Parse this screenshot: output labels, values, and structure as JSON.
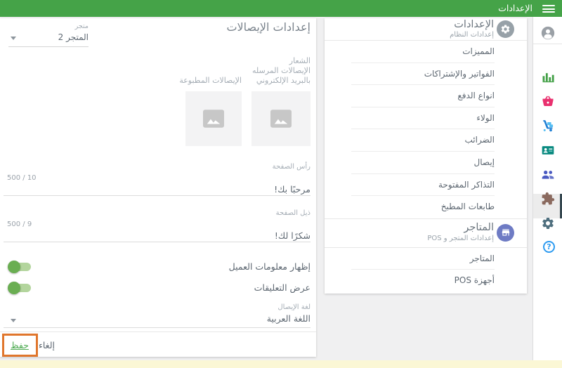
{
  "header": {
    "title": "الإعدادات"
  },
  "main_panel": {
    "title": "إعدادات الإيصالات",
    "store_select": {
      "label": "متجر",
      "value": "المتجر 2"
    },
    "logo_label": "الشعار",
    "email_receipts_label": "الإيصالات المرسله بالبريد الإلكتروني",
    "email_receipts_line1": "الإيصالات المرسله",
    "email_receipts_line2": "بالبريد الإلكتروني",
    "printed_receipts_label": "الإيصالات المطبوعة",
    "header_field": {
      "label": "رأس الصفحة",
      "counter": "500 / 10",
      "value": "مرحبًا بك!"
    },
    "footer_field": {
      "label": "ذيل الصفحة",
      "counter": "500 / 9",
      "value": "شكرًا لك!"
    },
    "toggles": [
      {
        "label": "إظهار معلومات العميل",
        "on": true
      },
      {
        "label": "عرض التعليقات",
        "on": true
      }
    ],
    "language_select": {
      "label": "لغة الإيصال",
      "value": "اللغة العربية"
    },
    "save_label": "حفظ",
    "cancel_label": "إلغاء"
  },
  "settings_menu": {
    "title": "الإعدادات",
    "subtitle": "إعدادات النظام",
    "items": [
      "المميزات",
      "الفواتير والإشتراكات",
      "انواع الدفع",
      "الولاء",
      "الضرائب",
      "إيصال",
      "التذاكر المفتوحة",
      "طابعات المطبخ"
    ],
    "stores_section": {
      "title": "المتاجر",
      "subtitle": "إعدادات المتجر و POS",
      "items": [
        "المتاجر",
        "أجهزة POS"
      ]
    }
  },
  "sidebar_icons": [
    "avatar-icon",
    "bar-chart-icon",
    "basket-icon",
    "hand-truck-icon",
    "contact-card-icon",
    "people-icon",
    "puzzle-icon",
    "gear-icon",
    "help-icon"
  ],
  "colors": {
    "appbar_green": "#45a348",
    "save_green": "#4caa50",
    "toggle_knob": "#6aae52",
    "toggle_track": "#b3d59d",
    "annotation_orange": "#e0762c",
    "stores_icon_indigo": "#6e7bc4",
    "settings_icon_gray": "#97a1a8",
    "bottom_strip_yellow": "#fbf7d5"
  }
}
